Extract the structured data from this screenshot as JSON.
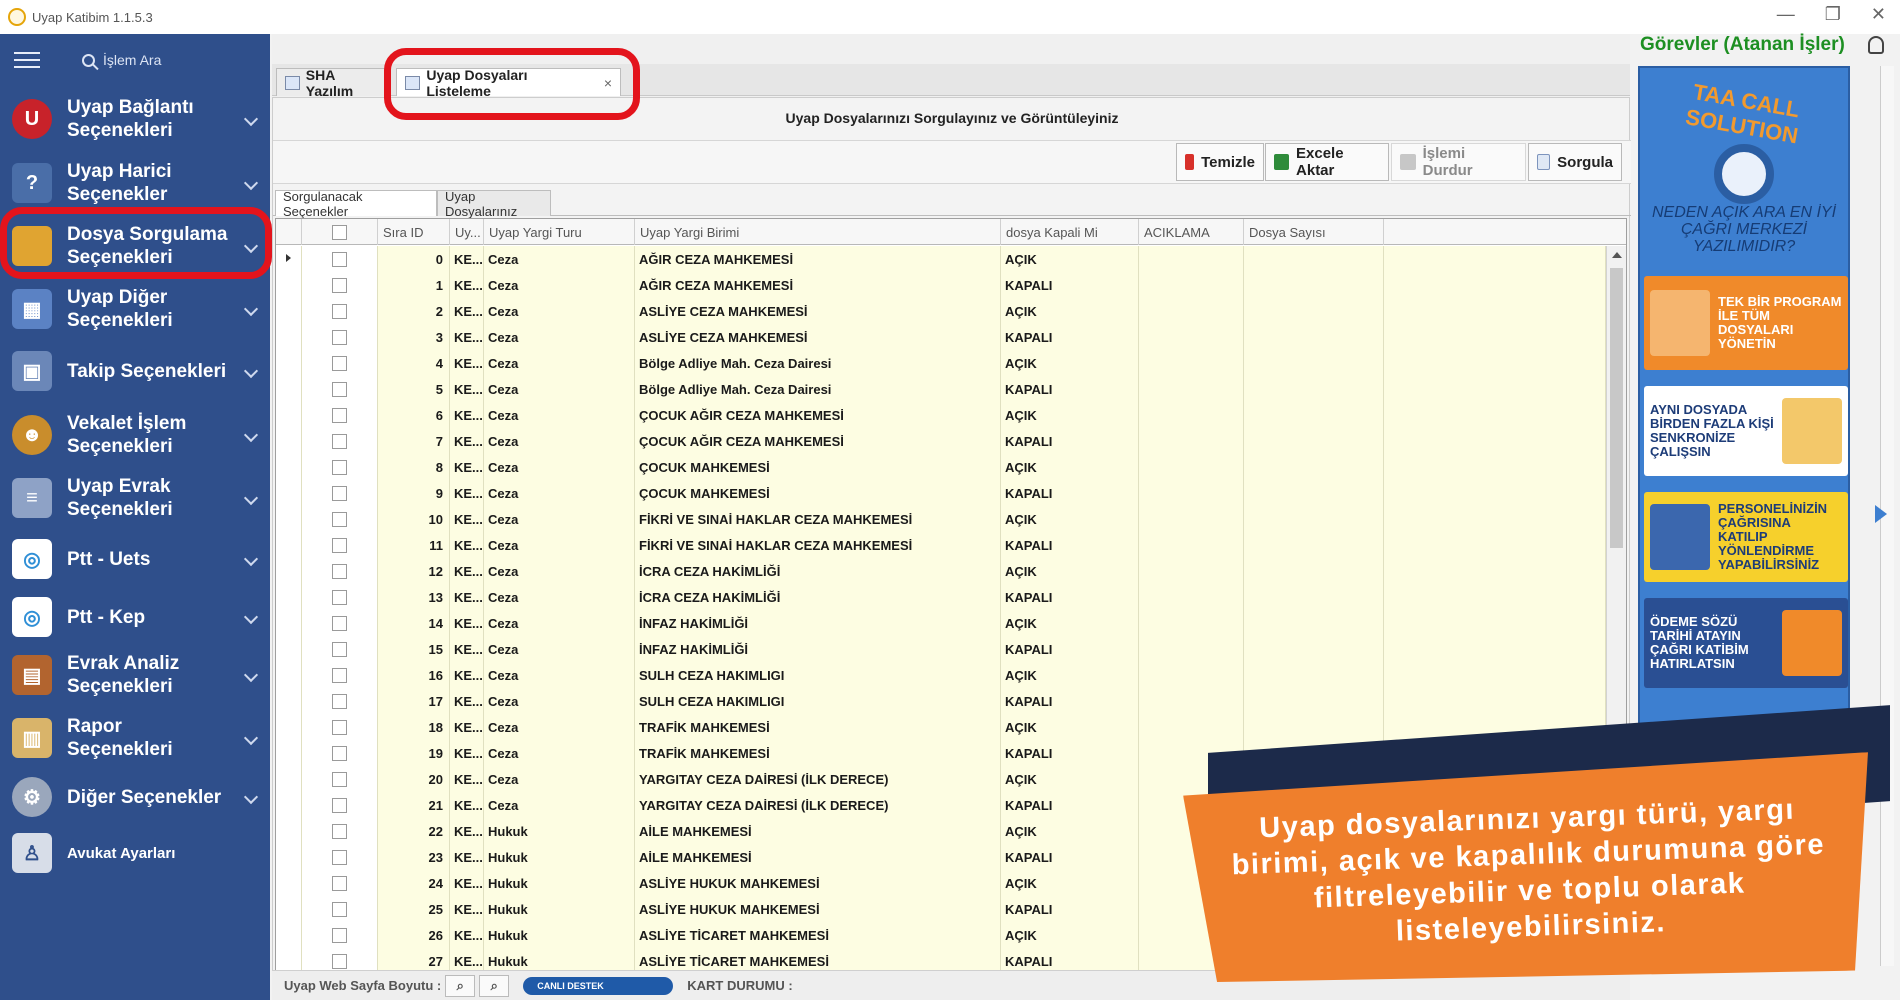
{
  "window": {
    "title": "Uyap Katibim 1.1.5.3",
    "controls": [
      "—",
      "❐",
      "✕"
    ]
  },
  "sidebar": {
    "search_placeholder": "İşlem Ara",
    "items": [
      {
        "label": "Uyap Bağlantı\nSeçenekleri",
        "icon": "uyap-icon",
        "color": "#c8222a"
      },
      {
        "label": "Uyap Harici\nSeçenekler",
        "icon": "question-book-icon",
        "color": "#4a6ea8"
      },
      {
        "label": "Dosya Sorgulama\nSeçenekleri",
        "icon": "folder-icon",
        "color": "#e0a431"
      },
      {
        "label": "Uyap Diğer\nSeçenekleri",
        "icon": "grid-icon",
        "color": "#5b82c4"
      },
      {
        "label": "Takip Seçenekleri",
        "icon": "frame-icon",
        "color": "#6b87b8"
      },
      {
        "label": "Vekalet İşlem\nSeçenekleri",
        "icon": "person-icon",
        "color": "#c98d2c"
      },
      {
        "label": "Uyap Evrak\nSeçenekleri",
        "icon": "document-icon",
        "color": "#8ea2c6"
      },
      {
        "label": "Ptt - Uets",
        "icon": "ptt-icon",
        "color": "#ffffff"
      },
      {
        "label": "Ptt - Kep",
        "icon": "ptt-icon",
        "color": "#ffffff"
      },
      {
        "label": "Evrak Analiz\nSeçenekleri",
        "icon": "briefcase-icon",
        "color": "#b2642f"
      },
      {
        "label": "Rapor\nSeçenekleri",
        "icon": "clipboard-icon",
        "color": "#d9b46a"
      },
      {
        "label": "Diğer Seçenekler",
        "icon": "gear-icon",
        "color": "#9aa7bc"
      },
      {
        "label": "Avukat Ayarları",
        "icon": "lawyer-icon",
        "color": "#d7dde8"
      }
    ]
  },
  "tabs": [
    {
      "label": "SHA Yazılım"
    },
    {
      "label": "Uyap Dosyaları Listeleme",
      "close": "×"
    }
  ],
  "panel": {
    "title": "Uyap Dosyalarınızı Sorgulayınız ve Görüntüleyiniz",
    "toolbar": {
      "clear": "Temizle",
      "export_excel": "Excele Aktar",
      "stop": "İşlemi Durdur",
      "query": "Sorgula"
    },
    "subtabs": [
      "Sorgulanacak Seçenekler",
      "Uyap Dosyalarınız"
    ]
  },
  "grid": {
    "columns": [
      "Sıra ID",
      "Uy...",
      "Uyap Yargi Turu",
      "Uyap Yargi Birimi",
      "dosya Kapali Mi",
      "ACIKLAMA",
      "Dosya Sayısı"
    ],
    "rows": [
      [
        "0",
        "KE...",
        "Ceza",
        "AĞIR CEZA MAHKEMESİ",
        "AÇIK"
      ],
      [
        "1",
        "KE...",
        "Ceza",
        "AĞIR CEZA MAHKEMESİ",
        "KAPALI"
      ],
      [
        "2",
        "KE...",
        "Ceza",
        "ASLİYE CEZA MAHKEMESİ",
        "AÇIK"
      ],
      [
        "3",
        "KE...",
        "Ceza",
        "ASLİYE CEZA MAHKEMESİ",
        "KAPALI"
      ],
      [
        "4",
        "KE...",
        "Ceza",
        "Bölge Adliye Mah. Ceza Dairesi",
        "AÇIK"
      ],
      [
        "5",
        "KE...",
        "Ceza",
        "Bölge Adliye Mah. Ceza Dairesi",
        "KAPALI"
      ],
      [
        "6",
        "KE...",
        "Ceza",
        "ÇOCUK AĞIR CEZA MAHKEMESİ",
        "AÇIK"
      ],
      [
        "7",
        "KE...",
        "Ceza",
        "ÇOCUK AĞIR CEZA MAHKEMESİ",
        "KAPALI"
      ],
      [
        "8",
        "KE...",
        "Ceza",
        "ÇOCUK MAHKEMESİ",
        "AÇIK"
      ],
      [
        "9",
        "KE...",
        "Ceza",
        "ÇOCUK MAHKEMESİ",
        "KAPALI"
      ],
      [
        "10",
        "KE...",
        "Ceza",
        "FİKRİ VE SINAİ HAKLAR CEZA MAHKEMESİ",
        "AÇIK"
      ],
      [
        "11",
        "KE...",
        "Ceza",
        "FİKRİ VE SINAİ HAKLAR CEZA MAHKEMESİ",
        "KAPALI"
      ],
      [
        "12",
        "KE...",
        "Ceza",
        "İCRA CEZA HAKİMLİĞİ",
        "AÇIK"
      ],
      [
        "13",
        "KE...",
        "Ceza",
        "İCRA CEZA HAKİMLİĞİ",
        "KAPALI"
      ],
      [
        "14",
        "KE...",
        "Ceza",
        "İNFAZ HAKİMLİĞİ",
        "AÇIK"
      ],
      [
        "15",
        "KE...",
        "Ceza",
        "İNFAZ HAKİMLİĞİ",
        "KAPALI"
      ],
      [
        "16",
        "KE...",
        "Ceza",
        "SULH CEZA HAKIMLIGI",
        "AÇIK"
      ],
      [
        "17",
        "KE...",
        "Ceza",
        "SULH CEZA HAKIMLIGI",
        "KAPALI"
      ],
      [
        "18",
        "KE...",
        "Ceza",
        "TRAFİK MAHKEMESİ",
        "AÇIK"
      ],
      [
        "19",
        "KE...",
        "Ceza",
        "TRAFİK MAHKEMESİ",
        "KAPALI"
      ],
      [
        "20",
        "KE...",
        "Ceza",
        "YARGITAY CEZA DAİRESİ (İLK DERECE)",
        "AÇIK"
      ],
      [
        "21",
        "KE...",
        "Ceza",
        "YARGITAY CEZA DAİRESİ (İLK DERECE)",
        "KAPALI"
      ],
      [
        "22",
        "KE...",
        "Hukuk",
        "AİLE MAHKEMESİ",
        "AÇIK"
      ],
      [
        "23",
        "KE...",
        "Hukuk",
        "AİLE MAHKEMESİ",
        "KAPALI"
      ],
      [
        "24",
        "KE...",
        "Hukuk",
        "ASLİYE HUKUK MAHKEMESİ",
        "AÇIK"
      ],
      [
        "25",
        "KE...",
        "Hukuk",
        "ASLİYE HUKUK MAHKEMESİ",
        "KAPALI"
      ],
      [
        "26",
        "KE...",
        "Hukuk",
        "ASLİYE TİCARET MAHKEMESİ",
        "AÇIK"
      ],
      [
        "27",
        "KE...",
        "Hukuk",
        "ASLİYE TİCARET MAHKEMESİ",
        "KAPALI"
      ]
    ]
  },
  "statusbar": {
    "page_size_label": "Uyap Web Sayfa Boyutu :",
    "live_support": "CANLI DESTEK",
    "card_status": "KART DURUMU :"
  },
  "tasks": {
    "title": "Görevler (Atanan İşler)"
  },
  "ad": {
    "logo": "TAA CALL SOLUTION",
    "question": "NEDEN AÇIK ARA EN İYİ ÇAĞRI MERKEZİ YAZILIMIDIR?",
    "cards": [
      {
        "text": "TEK BİR PROGRAM İLE TÜM DOSYALARI YÖNETİN",
        "bg": "#f08a2a",
        "fg": "#ffffff"
      },
      {
        "text": "AYNI DOSYADA BİRDEN FAZLA KİŞİ SENKRONİZE ÇALIŞSIN",
        "bg": "#ffffff",
        "fg": "#1d3c78"
      },
      {
        "text": "PERSONELİNİZİN ÇAĞRISINA KATILIP YÖNLENDİRME YAPABİLİRSİNİZ",
        "bg": "#f6d02c",
        "fg": "#1d3c78"
      },
      {
        "text": "ÖDEME SÖZÜ TARİHİ ATAYIN ÇAĞRI KATİBİM HATIRLATSIN",
        "bg": "#2a4f93",
        "fg": "#ffffff"
      }
    ]
  },
  "promo": {
    "text": "Uyap dosyalarınızı yargı türü, yargı birimi, açık ve kapalılık durumuna göre filtreleyebilir ve toplu olarak listeleyebilirsiniz."
  },
  "colors": {
    "sidebar_bg": "#2f4f8b",
    "row_bg": "#fdfde2",
    "highlight": "#e3141c",
    "promo_bg": "#ef7f2c",
    "tasks_title": "#1d8f22"
  }
}
